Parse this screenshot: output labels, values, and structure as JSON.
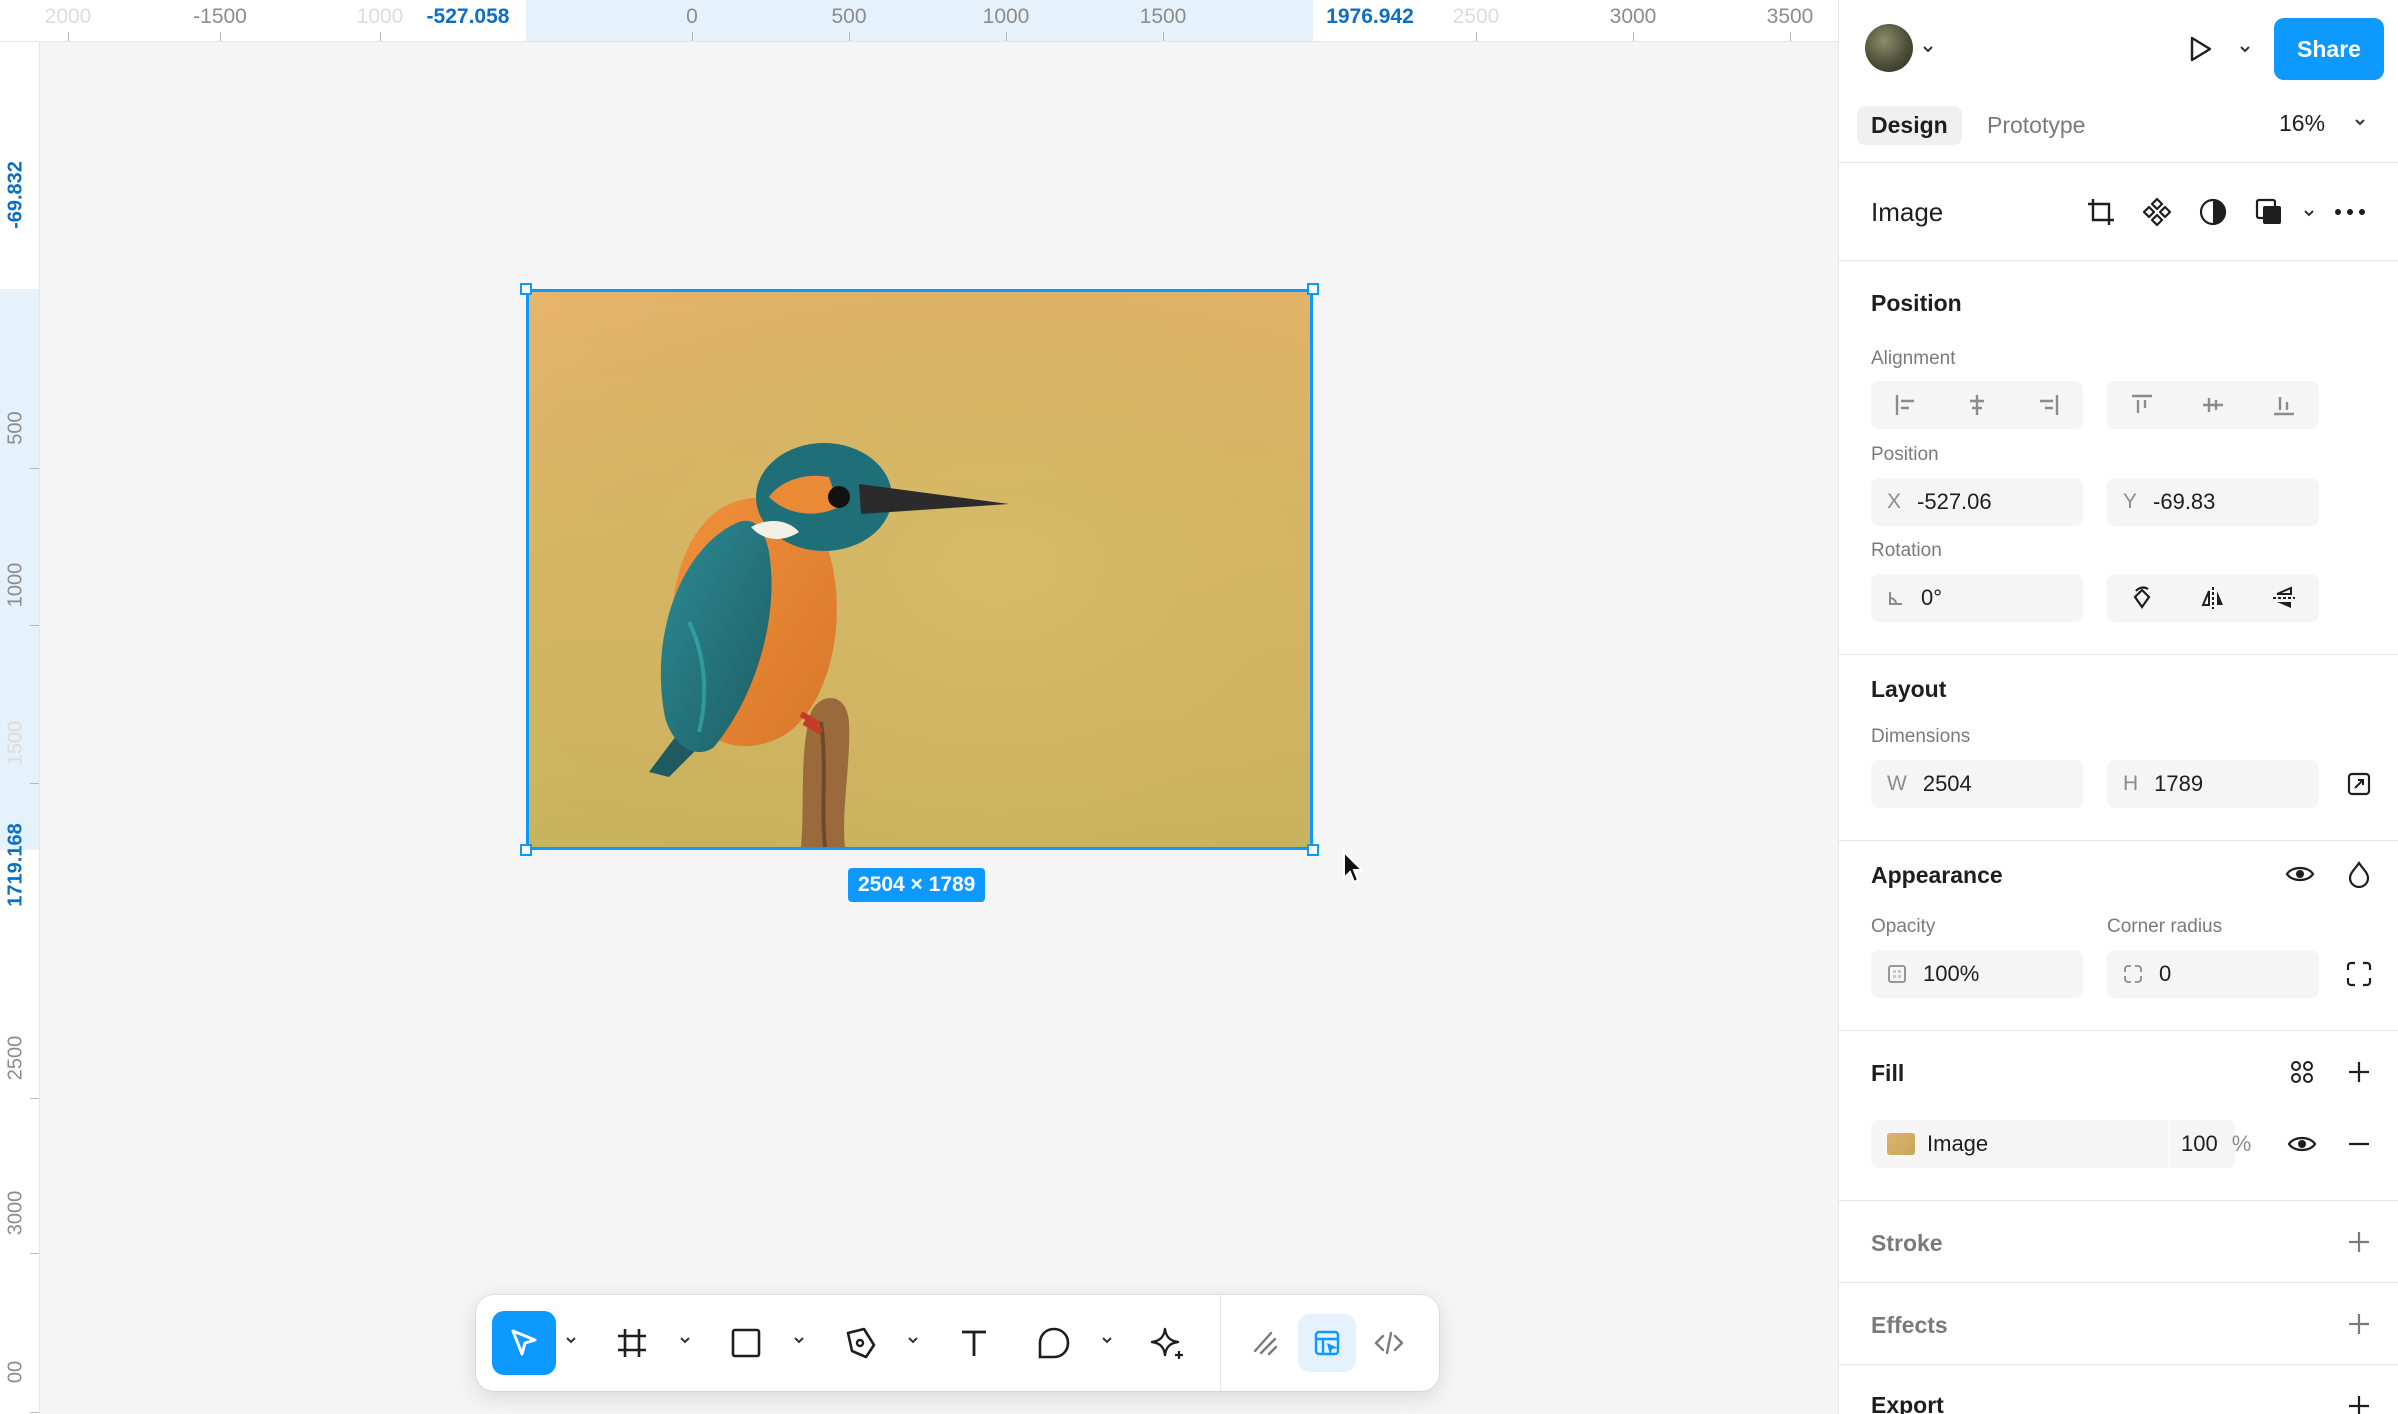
{
  "ruler": {
    "top": [
      {
        "label": "2000",
        "style": "faint"
      },
      {
        "label": "-1500",
        "style": "normal"
      },
      {
        "label": "1000",
        "style": "faint"
      },
      {
        "label": "-527.058",
        "style": "sel"
      },
      {
        "label": "0",
        "style": "normal"
      },
      {
        "label": "500",
        "style": "normal"
      },
      {
        "label": "1000",
        "style": "normal"
      },
      {
        "label": "1500",
        "style": "normal"
      },
      {
        "label": "1976.942",
        "style": "sel"
      },
      {
        "label": "2500",
        "style": "faint"
      },
      {
        "label": "3000",
        "style": "normal"
      },
      {
        "label": "3500",
        "style": "normal"
      }
    ],
    "left": [
      {
        "label": "-69.832",
        "style": "sel"
      },
      {
        "label": "500",
        "style": "normal"
      },
      {
        "label": "1000",
        "style": "normal"
      },
      {
        "label": "1500",
        "style": "faint"
      },
      {
        "label": "1719.168",
        "style": "sel"
      },
      {
        "label": "2500",
        "style": "normal"
      },
      {
        "label": "3000",
        "style": "normal"
      },
      {
        "label": "00",
        "style": "normal"
      }
    ]
  },
  "canvas": {
    "dimension_badge": "2504 × 1789",
    "selection_color": "#0d99ff"
  },
  "toolbar": {
    "tools": [
      {
        "name": "move-tool",
        "icon": "cursor-arrow-icon",
        "active": true
      },
      {
        "name": "frame-tool",
        "icon": "frame-hash-icon"
      },
      {
        "name": "shape-tool",
        "icon": "rectangle-icon"
      },
      {
        "name": "pen-tool",
        "icon": "pen-icon"
      },
      {
        "name": "text-tool",
        "icon": "text-t-icon"
      },
      {
        "name": "comment-tool",
        "icon": "speech-bubble-icon"
      },
      {
        "name": "ai-tool",
        "icon": "sparkle-icon"
      }
    ],
    "modes": [
      "draw-mode-icon",
      "design-mode-icon",
      "dev-mode-icon"
    ]
  },
  "panel": {
    "share_label": "Share",
    "tabs": {
      "design": "Design",
      "prototype": "Prototype"
    },
    "zoom": "16%",
    "layer_type": "Image",
    "position": {
      "title": "Position",
      "alignment_label": "Alignment",
      "position_label": "Position",
      "x_prefix": "X",
      "x_value": "-527.06",
      "y_prefix": "Y",
      "y_value": "-69.83",
      "rotation_label": "Rotation",
      "rotation_value": "0°"
    },
    "layout": {
      "title": "Layout",
      "dimensions_label": "Dimensions",
      "w_prefix": "W",
      "w_value": "2504",
      "h_prefix": "H",
      "h_value": "1789"
    },
    "appearance": {
      "title": "Appearance",
      "opacity_label": "Opacity",
      "opacity_value": "100%",
      "corner_label": "Corner radius",
      "corner_value": "0"
    },
    "fill": {
      "title": "Fill",
      "type": "Image",
      "opacity": "100",
      "unit": "%"
    },
    "stroke_title": "Stroke",
    "effects_title": "Effects",
    "export_title": "Export",
    "accent": "#0d99ff"
  }
}
